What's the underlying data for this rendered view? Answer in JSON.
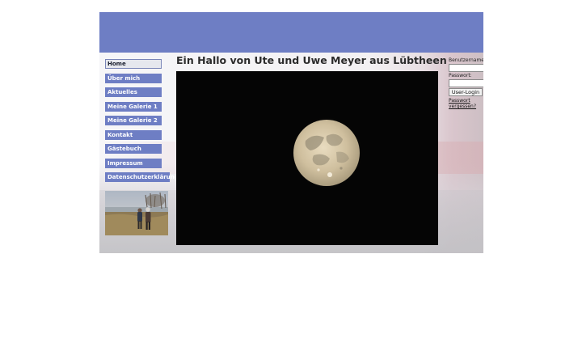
{
  "page": {
    "headline": "Ein Hallo von Ute und Uwe Meyer aus Lübtheen"
  },
  "nav": {
    "items": [
      {
        "label": "Home",
        "active": true
      },
      {
        "label": "Über mich",
        "active": false
      },
      {
        "label": "Aktuelles",
        "active": false
      },
      {
        "label": "Meine Galerie 1",
        "active": false
      },
      {
        "label": "Meine Galerie 2",
        "active": false
      },
      {
        "label": "Kontakt",
        "active": false
      },
      {
        "label": "Gästebuch",
        "active": false
      },
      {
        "label": "Impressum",
        "active": false
      },
      {
        "label": "Datenschutzerklärung",
        "active": false
      }
    ]
  },
  "login": {
    "username_label": "Benutzername:",
    "username_value": "",
    "password_label": "Passwort:",
    "password_value": "",
    "login_button": "User-Login",
    "forgot_link": "Passwort vergessen?"
  },
  "colors": {
    "banner": "#6e7ec4",
    "nav_item": "#6e7ec4",
    "nav_active": "#e6e8ee",
    "moon_background": "#050505"
  },
  "icons": {
    "main_image": "full-moon-photo",
    "sidebar_image": "couple-at-lake-photo"
  }
}
